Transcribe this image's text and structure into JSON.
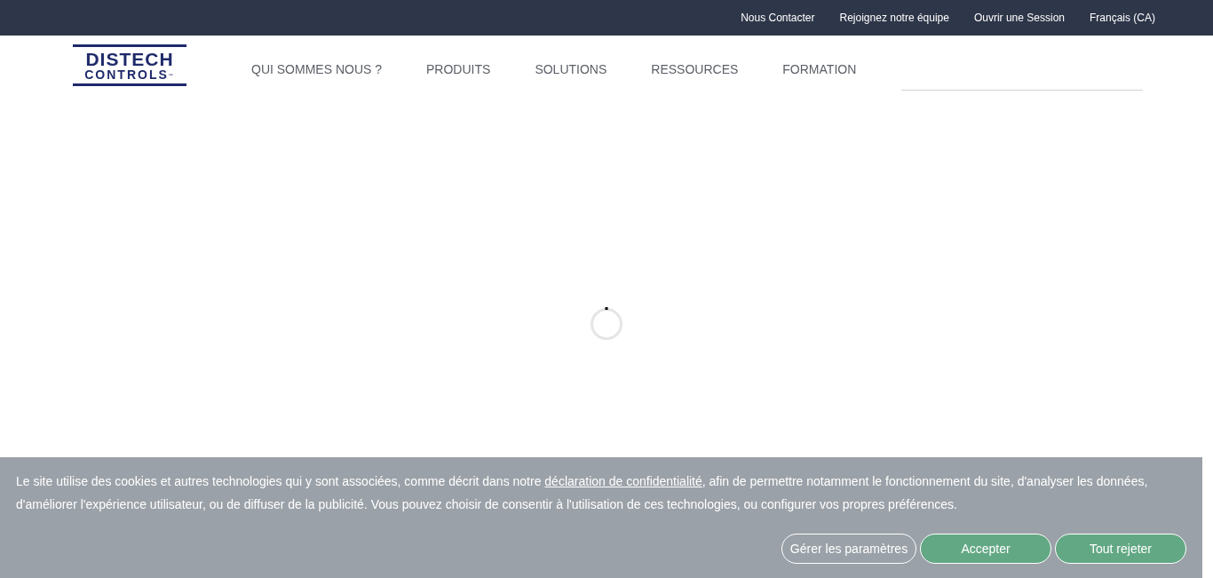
{
  "top_links": [
    "Nous Contacter",
    "Rejoignez notre équipe",
    "Ouvrir une Session",
    "Français (CA)"
  ],
  "logo": {
    "line_1": "DISTECH",
    "line_2": "CONTROLS",
    "mark": "™"
  },
  "nav": [
    "QUI SOMMES NOUS ?",
    "PRODUITS",
    "SOLUTIONS",
    "RESSOURCES",
    "FORMATION"
  ],
  "cookie_banner": {
    "text_before": "Le site utilise des cookies et autres technologies qui y sont associées, comme décrit dans notre ",
    "link": "déclaration de confidentialité",
    "text_after": ", afin de permettre notamment le fonctionnement du site, d'analyser les données, d'améliorer l'expérience utilisateur, ou de diffuser de la publicité. Vous pouvez choisir de consentir à l'utilisation de ces technologies, ou configurer vos propres préférences.",
    "buttons": [
      {
        "label": "Gérer les paramètres",
        "kind": "outline"
      },
      {
        "label": "Accepter",
        "kind": "filled"
      },
      {
        "label": "Tout rejeter",
        "kind": "filled"
      }
    ]
  }
}
